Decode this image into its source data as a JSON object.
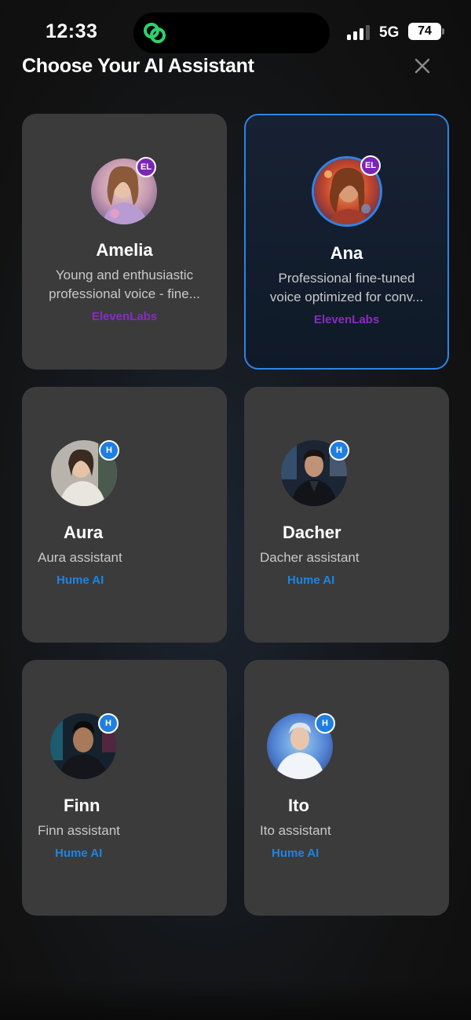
{
  "status_bar": {
    "time": "12:33",
    "network": "5G",
    "battery": "74",
    "signal_bars": 3
  },
  "header": {
    "title": "Choose Your AI Assistant",
    "close_icon": "close-icon"
  },
  "colors": {
    "accent": "#2f84e6",
    "elevenlabs": "#8a2bc0",
    "hume": "#1e84e0",
    "card_bg": "#3b3b3c"
  },
  "assistants": [
    {
      "name": "Amelia",
      "desc_line1": "Young and enthusiastic",
      "desc_line2": "professional voice - fine...",
      "provider": "ElevenLabs",
      "badge": "EL",
      "selected": false
    },
    {
      "name": "Ana",
      "desc_line1": "Professional fine-tuned",
      "desc_line2": "voice optimized for conv...",
      "provider": "ElevenLabs",
      "badge": "EL",
      "selected": true
    },
    {
      "name": "Aura",
      "desc_line1": "Aura assistant",
      "provider": "Hume AI",
      "badge": "H",
      "selected": false
    },
    {
      "name": "Dacher",
      "desc_line1": "Dacher assistant",
      "provider": "Hume AI",
      "badge": "H",
      "selected": false
    },
    {
      "name": "Finn",
      "desc_line1": "Finn assistant",
      "provider": "Hume AI",
      "badge": "H",
      "selected": false
    },
    {
      "name": "Ito",
      "desc_line1": "Ito assistant",
      "provider": "Hume AI",
      "badge": "H",
      "selected": false
    }
  ]
}
